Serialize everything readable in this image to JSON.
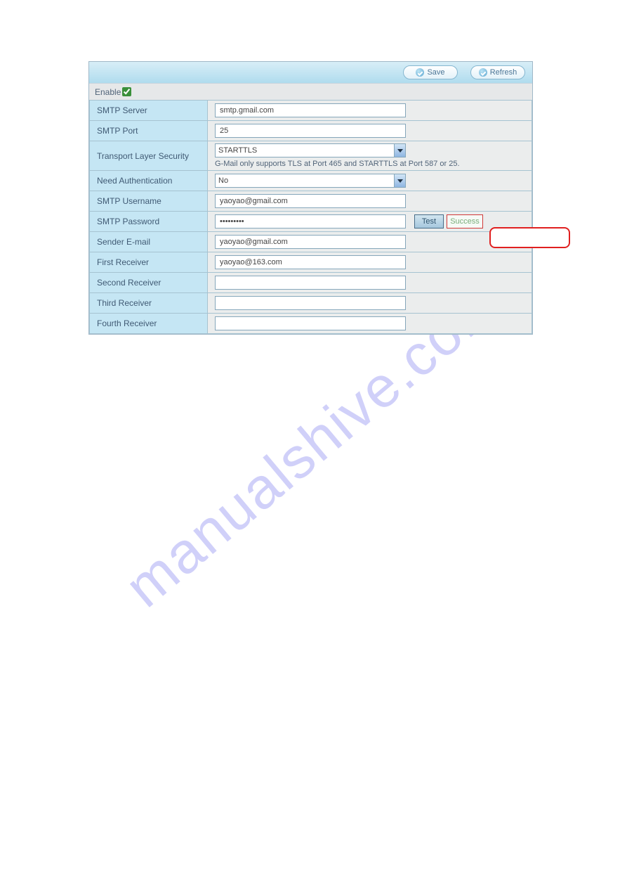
{
  "toolbar": {
    "save_label": "Save",
    "refresh_label": "Refresh"
  },
  "enable": {
    "label": "Enable",
    "checked": true
  },
  "fields": {
    "smtp_server": {
      "label": "SMTP Server",
      "value": "smtp.gmail.com"
    },
    "smtp_port": {
      "label": "SMTP Port",
      "value": "25"
    },
    "tls": {
      "label": "Transport Layer Security",
      "value": "STARTTLS",
      "hint": "G-Mail only supports TLS at Port 465 and STARTTLS at Port 587 or 25."
    },
    "need_auth": {
      "label": "Need Authentication",
      "value": "No"
    },
    "smtp_user": {
      "label": "SMTP Username",
      "value": "yaoyao@gmail.com"
    },
    "smtp_pass": {
      "label": "SMTP Password",
      "value": "•••••••••",
      "test_label": "Test",
      "result_label": "Success"
    },
    "sender": {
      "label": "Sender E-mail",
      "value": "yaoyao@gmail.com"
    },
    "recv1": {
      "label": "First Receiver",
      "value": "yaoyao@163.com"
    },
    "recv2": {
      "label": "Second Receiver",
      "value": ""
    },
    "recv3": {
      "label": "Third Receiver",
      "value": ""
    },
    "recv4": {
      "label": "Fourth Receiver",
      "value": ""
    }
  },
  "watermark": "manualshive.com"
}
